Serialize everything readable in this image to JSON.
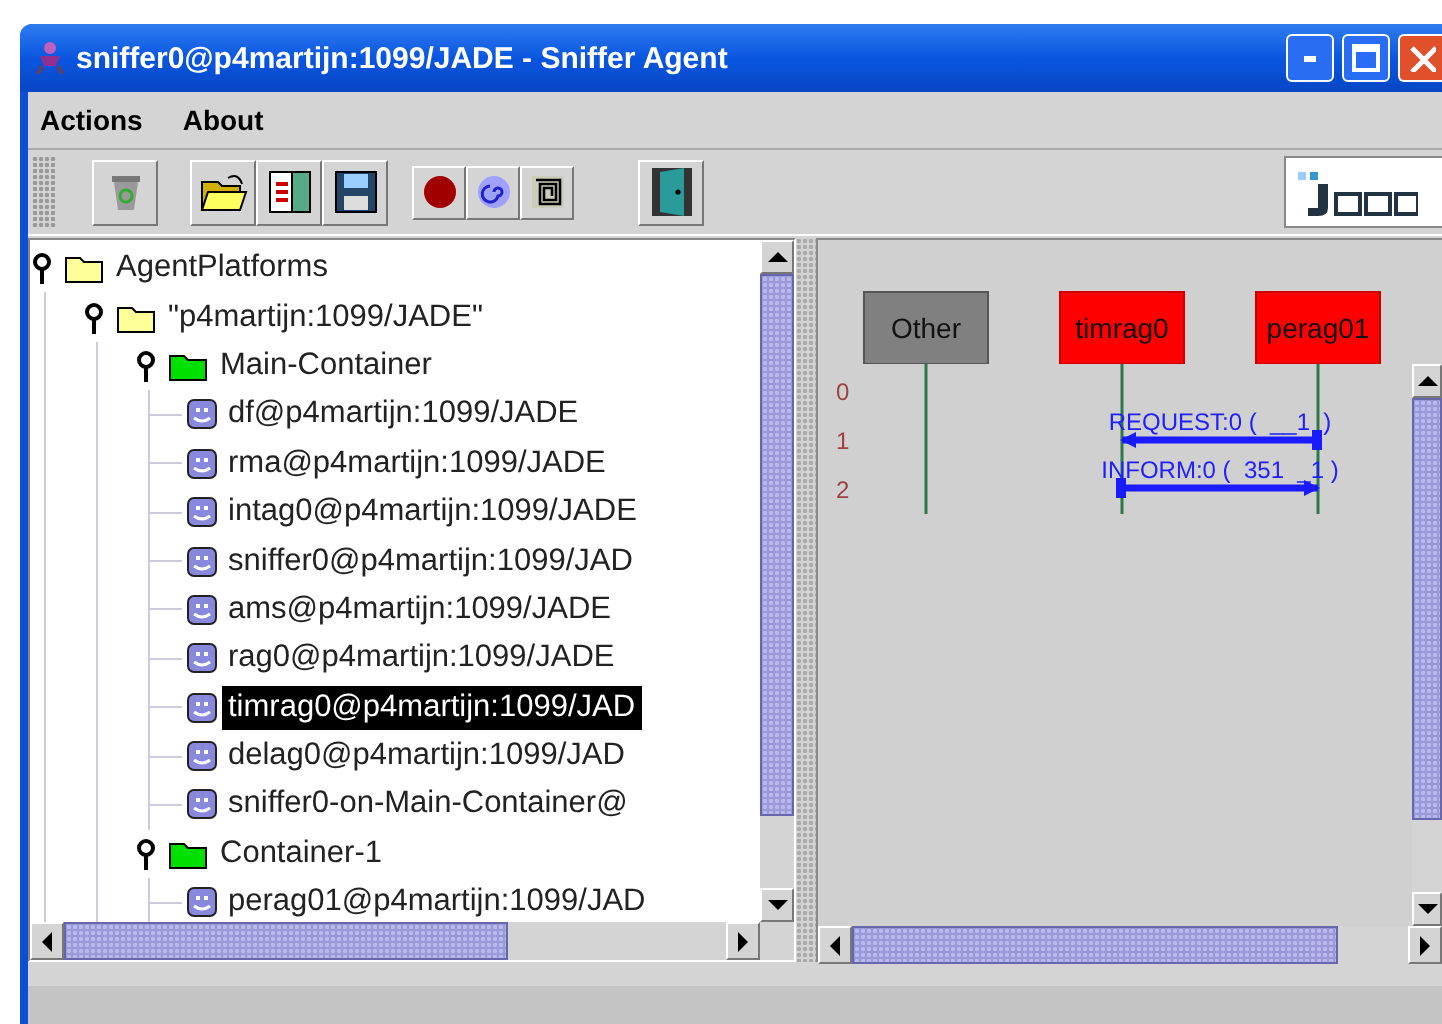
{
  "window": {
    "title": "sniffer0@p4martijn:1099/JADE - Sniffer Agent"
  },
  "menu": [
    "Actions",
    "About"
  ],
  "tree": [
    {
      "label": "AgentPlatforms",
      "kind": "platforms",
      "expanded": true,
      "selected": false,
      "children": [
        {
          "label": "\"p4martijn:1099/JADE\"",
          "kind": "platform",
          "expanded": true,
          "selected": false,
          "children": [
            {
              "label": "Main-Container",
              "kind": "container",
              "expanded": true,
              "selected": false,
              "children": [
                {
                  "label": "df@p4martijn:1099/JADE",
                  "kind": "agent",
                  "selected": false
                },
                {
                  "label": "rma@p4martijn:1099/JADE",
                  "kind": "agent",
                  "selected": false
                },
                {
                  "label": "intag0@p4martijn:1099/JADE",
                  "kind": "agent",
                  "selected": false
                },
                {
                  "label": "sniffer0@p4martijn:1099/JAD",
                  "kind": "agent",
                  "selected": false
                },
                {
                  "label": "ams@p4martijn:1099/JADE",
                  "kind": "agent",
                  "selected": false
                },
                {
                  "label": "rag0@p4martijn:1099/JADE",
                  "kind": "agent",
                  "selected": false
                },
                {
                  "label": "timrag0@p4martijn:1099/JAD",
                  "kind": "agent",
                  "selected": true
                },
                {
                  "label": "delag0@p4martijn:1099/JAD",
                  "kind": "agent",
                  "selected": false
                },
                {
                  "label": "sniffer0-on-Main-Container@",
                  "kind": "agent",
                  "selected": false
                }
              ]
            },
            {
              "label": "Container-1",
              "kind": "container",
              "expanded": true,
              "selected": false,
              "children": [
                {
                  "label": "perag01@p4martijn:1099/JAD",
                  "kind": "agent",
                  "selected": false
                }
              ]
            }
          ]
        }
      ]
    }
  ],
  "diagram": {
    "agents": [
      {
        "name": "Other",
        "color": "#808080"
      },
      {
        "name": "timrag0",
        "color": "#ff0000"
      },
      {
        "name": "perag01",
        "color": "#ff0000"
      }
    ],
    "rows": [
      "0",
      "1",
      "2"
    ],
    "messages": [
      {
        "label": "REQUEST:0 (  __1  )",
        "kind": "leftward"
      },
      {
        "label": "INFORM:0 (  351  _1 )",
        "kind": "rightward"
      }
    ]
  }
}
